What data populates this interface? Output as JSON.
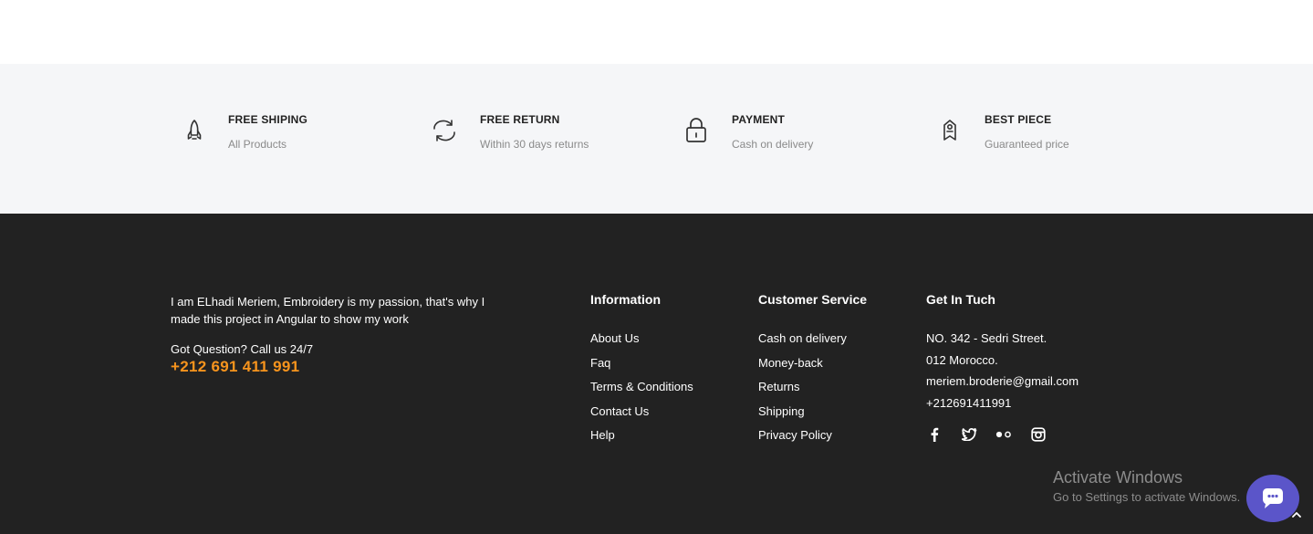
{
  "features": [
    {
      "icon": "rocket-icon",
      "title": "FREE SHIPING",
      "subtitle": "All Products"
    },
    {
      "icon": "refresh-icon",
      "title": "FREE RETURN",
      "subtitle": "Within 30 days returns"
    },
    {
      "icon": "lock-icon",
      "title": "PAYMENT",
      "subtitle": "Cash on delivery"
    },
    {
      "icon": "tag-icon",
      "title": "BEST PIECE",
      "subtitle": "Guaranteed price"
    }
  ],
  "footer": {
    "about_text": "I am ELhadi Meriem, Embroidery is my passion, that's why I made this project in Angular to show my work",
    "question_text": "Got Question? Call us 24/7",
    "phone_display": "+212 691 411 991",
    "phone_color": "#f7941d",
    "information": {
      "heading": "Information",
      "links": [
        "About Us",
        "Faq",
        "Terms & Conditions",
        "Contact Us",
        "Help"
      ]
    },
    "customer_service": {
      "heading": "Customer Service",
      "links": [
        "Cash on delivery",
        "Money-back",
        "Returns",
        "Shipping",
        "Privacy Policy"
      ]
    },
    "get_in_touch": {
      "heading": "Get In Tuch",
      "lines": [
        "NO. 342 - Sedri Street.",
        "012 Morocco.",
        "meriem.broderie@gmail.com",
        "+212691411991"
      ]
    },
    "socials": [
      "facebook-icon",
      "twitter-icon",
      "flickr-icon",
      "instagram-icon"
    ]
  },
  "watermark": {
    "title": "Activate Windows",
    "subtitle": "Go to Settings to activate Windows."
  },
  "colors": {
    "features_bg": "#f5f6f8",
    "footer_bg": "#222222",
    "chat_button": "#5b55c9"
  }
}
